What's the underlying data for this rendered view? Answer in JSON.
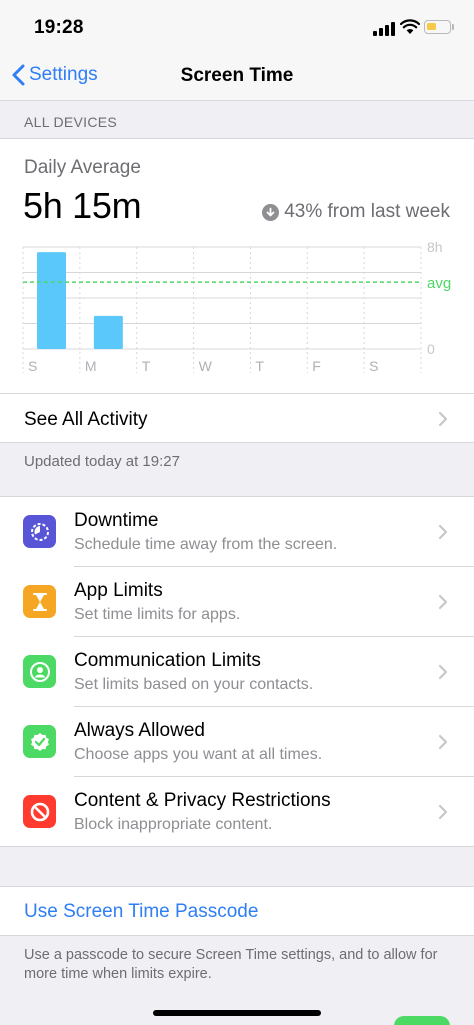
{
  "status_bar": {
    "time": "19:28",
    "battery_level": 0.45
  },
  "nav": {
    "back_label": "Settings",
    "title": "Screen Time"
  },
  "section_all_devices": "ALL DEVICES",
  "summary": {
    "daily_label": "Daily Average",
    "daily_value": "5h 15m",
    "trend_text": "43% from last week"
  },
  "chart_data": {
    "type": "bar",
    "categories": [
      "S",
      "M",
      "T",
      "W",
      "T",
      "F",
      "S"
    ],
    "values": [
      7.6,
      2.6,
      0,
      0,
      0,
      0,
      0
    ],
    "ylim": [
      0,
      8
    ],
    "y_tick_labels": [
      "8h",
      "0"
    ],
    "average": 5.25,
    "average_label": "avg",
    "colors": {
      "bar": "#5ac8fa",
      "avg_line": "#4cd964",
      "grid": "#d8d8dc"
    }
  },
  "see_all": {
    "label": "See All Activity"
  },
  "updated_text": "Updated today at 19:27",
  "settings_items": [
    {
      "title": "Downtime",
      "subtitle": "Schedule time away from the screen.",
      "icon": "downtime-icon",
      "color": "#5856d6"
    },
    {
      "title": "App Limits",
      "subtitle": "Set time limits for apps.",
      "icon": "hourglass-icon",
      "color": "#f5a623"
    },
    {
      "title": "Communication Limits",
      "subtitle": "Set limits based on your contacts.",
      "icon": "contact-icon",
      "color": "#4cd964"
    },
    {
      "title": "Always Allowed",
      "subtitle": "Choose apps you want at all times.",
      "icon": "checkmark-seal-icon",
      "color": "#4cd964"
    },
    {
      "title": "Content & Privacy Restrictions",
      "subtitle": "Block inappropriate content.",
      "icon": "restriction-icon",
      "color": "#ff3b30"
    }
  ],
  "passcode": {
    "link_label": "Use Screen Time Passcode",
    "note": "Use a passcode to secure Screen Time settings, and to allow for more time when limits expire."
  }
}
